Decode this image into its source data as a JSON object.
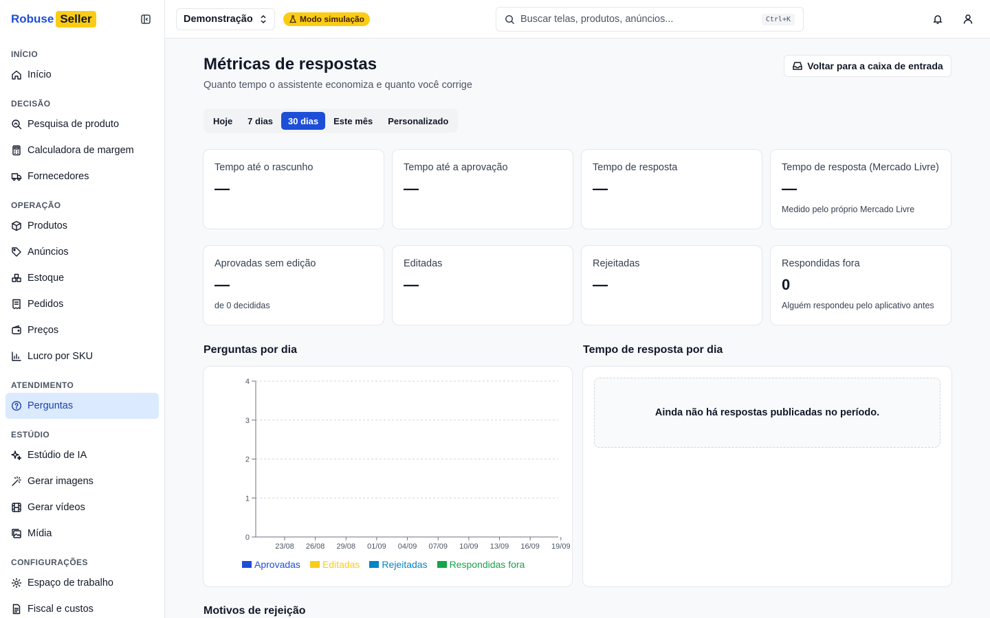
{
  "brand": {
    "part1": "Robuse",
    "part2": "Seller"
  },
  "sidebar": {
    "sections": [
      {
        "title": "INÍCIO",
        "items": [
          {
            "label": "Início",
            "icon": "home-icon"
          }
        ]
      },
      {
        "title": "DECISÃO",
        "items": [
          {
            "label": "Pesquisa de produto",
            "icon": "search-chart-icon"
          },
          {
            "label": "Calculadora de margem",
            "icon": "calculator-icon"
          },
          {
            "label": "Fornecedores",
            "icon": "truck-icon"
          }
        ]
      },
      {
        "title": "OPERAÇÃO",
        "items": [
          {
            "label": "Produtos",
            "icon": "package-icon"
          },
          {
            "label": "Anúncios",
            "icon": "tag-icon"
          },
          {
            "label": "Estoque",
            "icon": "boxes-icon"
          },
          {
            "label": "Pedidos",
            "icon": "receipt-icon"
          },
          {
            "label": "Preços",
            "icon": "wallet-icon"
          },
          {
            "label": "Lucro por SKU",
            "icon": "bar-chart-icon"
          }
        ]
      },
      {
        "title": "ATENDIMENTO",
        "items": [
          {
            "label": "Perguntas",
            "icon": "question-bubble-icon",
            "active": true
          }
        ]
      },
      {
        "title": "ESTÚDIO",
        "items": [
          {
            "label": "Estúdio de IA",
            "icon": "sparkles-icon"
          },
          {
            "label": "Gerar imagens",
            "icon": "wand-icon"
          },
          {
            "label": "Gerar vídeos",
            "icon": "film-icon"
          },
          {
            "label": "Mídia",
            "icon": "images-icon"
          }
        ]
      },
      {
        "title": "CONFIGURAÇÕES",
        "items": [
          {
            "label": "Espaço de trabalho",
            "icon": "gear-icon"
          },
          {
            "label": "Fiscal e custos",
            "icon": "document-icon"
          }
        ]
      }
    ]
  },
  "header": {
    "workspace": "Demonstração",
    "sim_badge": "Modo simulação",
    "search_placeholder": "Buscar telas, produtos, anúncios...",
    "search_shortcut": "Ctrl+K"
  },
  "page": {
    "title": "Métricas de respostas",
    "subtitle": "Quanto tempo o assistente economiza e quanto você corrige",
    "back_button": "Voltar para a caixa de entrada",
    "ranges": [
      "Hoje",
      "7 dias",
      "30 dias",
      "Este mês",
      "Personalizado"
    ],
    "active_range": "30 dias"
  },
  "metrics": [
    {
      "label": "Tempo até o rascunho",
      "value": "—",
      "note": ""
    },
    {
      "label": "Tempo até a aprovação",
      "value": "—",
      "note": ""
    },
    {
      "label": "Tempo de resposta",
      "value": "—",
      "note": ""
    },
    {
      "label": "Tempo de resposta (Mercado Livre)",
      "value": "—",
      "note": "Medido pelo próprio Mercado Livre"
    },
    {
      "label": "Aprovadas sem edição",
      "value": "—",
      "note": "de 0 decididas"
    },
    {
      "label": "Editadas",
      "value": "—",
      "note": ""
    },
    {
      "label": "Rejeitadas",
      "value": "—",
      "note": ""
    },
    {
      "label": "Respondidas fora",
      "value": "0",
      "note": "Alguém respondeu pelo aplicativo antes"
    }
  ],
  "sections": {
    "per_day": "Perguntas por dia",
    "response_time": "Tempo de resposta por dia",
    "response_empty": "Ainda não há respostas publicadas no período.",
    "rejection_reasons": "Motivos de rejeição"
  },
  "colors": {
    "accent": "#1d4ed8",
    "approved": "#1d4ed8",
    "edited": "#facc15",
    "rejected": "#0284c7",
    "outside": "#16a34a"
  },
  "chart_data": {
    "type": "bar",
    "title": "Perguntas por dia",
    "categories": [
      "23/08",
      "26/08",
      "29/08",
      "01/09",
      "04/09",
      "07/09",
      "10/09",
      "13/09",
      "16/09",
      "19/09"
    ],
    "yticks": [
      "0",
      "1",
      "2",
      "3",
      "4"
    ],
    "ylim": [
      0,
      4
    ],
    "grid": true,
    "legend_position": "bottom",
    "series": [
      {
        "name": "Aprovadas",
        "color": "#1d4ed8",
        "values": [
          0,
          0,
          0,
          0,
          0,
          0,
          0,
          0,
          0,
          0
        ]
      },
      {
        "name": "Editadas",
        "color": "#facc15",
        "values": [
          0,
          0,
          0,
          0,
          0,
          0,
          0,
          0,
          0,
          0
        ]
      },
      {
        "name": "Rejeitadas",
        "color": "#0284c7",
        "values": [
          0,
          0,
          0,
          0,
          0,
          0,
          0,
          0,
          0,
          0
        ]
      },
      {
        "name": "Respondidas fora",
        "color": "#16a34a",
        "values": [
          0,
          0,
          0,
          0,
          0,
          0,
          0,
          0,
          0,
          0
        ]
      }
    ]
  }
}
